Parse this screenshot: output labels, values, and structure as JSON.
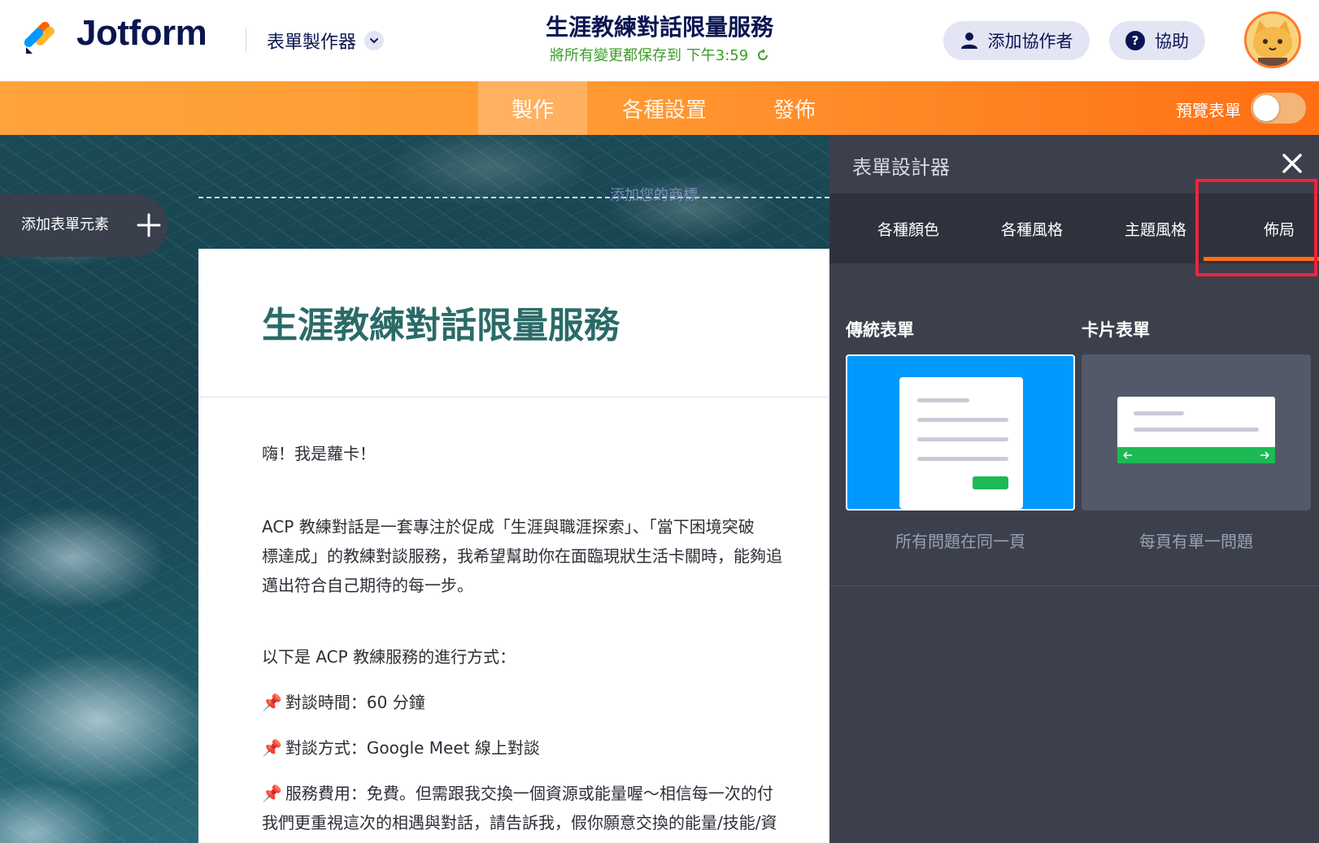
{
  "header": {
    "brand": "Jotform",
    "builder_menu_label": "表單製作器",
    "form_title": "生涯教練對話限量服務",
    "save_status": "將所有變更都保存到 下午3:59",
    "add_collaborator_label": "添加協作者",
    "help_label": "協助"
  },
  "nav": {
    "tabs": [
      {
        "label": "製作"
      },
      {
        "label": "各種設置"
      },
      {
        "label": "發佈"
      }
    ],
    "preview_label": "預覽表單"
  },
  "canvas": {
    "add_element_label": "添加表單元素",
    "logo_hint": "添加您的商標",
    "form": {
      "title": "生涯教練對話限量服務",
      "paragraphs": [
        "嗨！我是蘿卡！",
        "ACP 教練對話是一套專注於促成「生涯與職涯探索」、「當下困境突破",
        "標達成」的教練對談服務，我希望幫助你在面臨現狀生活卡關時，能夠追",
        "邁出符合自己期待的每一步。",
        "以下是 ACP 教練服務的進行方式：",
        "對談時間：60 分鐘",
        "對談方式：Google Meet 線上對談",
        "服務費用：免費。但需跟我交換一個資源或能量喔～相信每一次的付",
        "我們更重視這次的相遇與對話，請告訴我，假你願意交換的能量/技能/資"
      ]
    }
  },
  "designer": {
    "title": "表單設計器",
    "tabs": [
      {
        "label": "各種顏色"
      },
      {
        "label": "各種風格"
      },
      {
        "label": "主題風格"
      },
      {
        "label": "佈局"
      }
    ],
    "active_tab": "佈局",
    "layouts": [
      {
        "label": "傳統表單",
        "description": "所有問題在同一頁"
      },
      {
        "label": "卡片表單",
        "description": "每頁有單一問題"
      }
    ]
  },
  "colors": {
    "brand_navy": "#0a1551",
    "accent_orange": "#ff6f14",
    "save_green": "#3c9d2a",
    "panel_bg": "#3c404d",
    "highlight_red": "#f0233d",
    "classic_blue": "#0099ff",
    "card_green": "#1db954"
  }
}
